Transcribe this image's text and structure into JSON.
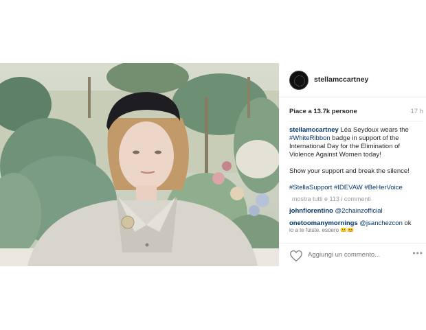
{
  "post": {
    "username": "stellamccartney",
    "likes_text": "Piace a 13.7k persone",
    "time": "17 h",
    "caption": {
      "author": "stellamccartney",
      "part1": " Léa Seydoux wears the ",
      "tag1": "#WhiteRibbon",
      "part2": " badge in support of the International Day for the Elimination of Violence Against Women today!",
      "para2": "Show your support and break the silence!",
      "tag2": "#StellaSupport",
      "tag3": "#IDEVAW",
      "tag4": "#BeHerVoice"
    },
    "more_comments": "mostra tutti e 113 i commenti",
    "comments": [
      {
        "author": "johnfiorentino",
        "text": " ",
        "mention": "@2chainzofficial"
      },
      {
        "author": "onetoomanymornings",
        "text": " ",
        "mention": "@jsanchezcon",
        "tail": " ok"
      }
    ],
    "comment_cutoff": "io a te fuiste, espero 🙂😊",
    "comment_placeholder": "Aggiungi un commento...",
    "more_icon": "•••"
  },
  "icons": {
    "like": "heart-outline-icon",
    "options": "more-options-icon"
  }
}
